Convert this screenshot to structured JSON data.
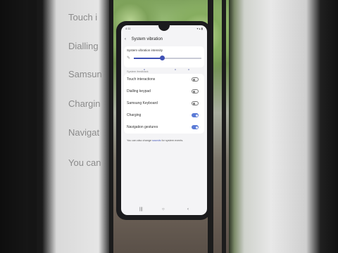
{
  "background_labels": [
    "Touch i",
    "Dialling",
    "Samsun",
    "Chargin",
    "Navigat",
    "You can"
  ],
  "screen": {
    "status_time": "4:11",
    "status_icons": "▾ ▴ ▮",
    "title": "System vibration",
    "intensity": {
      "label": "System vibration intensity",
      "level": 0.42
    },
    "section_label": "System feedback",
    "items": [
      {
        "label": "Touch interactions",
        "on": false
      },
      {
        "label": "Dialling keypad",
        "on": false
      },
      {
        "label": "Samsung Keyboard",
        "on": false
      },
      {
        "label": "Charging",
        "on": true
      },
      {
        "label": "Navigation gestures",
        "on": true
      }
    ],
    "footer": {
      "before": "You can also change ",
      "link": "sounds",
      "after": " for system events."
    },
    "nav": {
      "recents": "|||",
      "home": "○",
      "back": "‹"
    }
  },
  "colors": {
    "accent": "#3f51b5",
    "toggle_on": "#5b7bd6",
    "screen_bg": "#f4f4f6"
  }
}
